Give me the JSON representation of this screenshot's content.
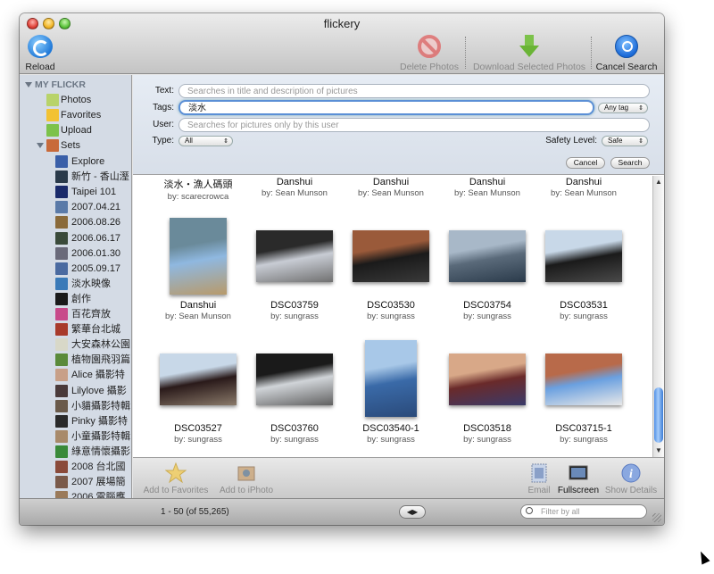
{
  "window": {
    "title": "flickery"
  },
  "toolbar": {
    "reload": "Reload",
    "delete": "Delete Photos",
    "download": "Download Selected Photos",
    "cancel_search": "Cancel Search"
  },
  "sidebar": {
    "section": "MY FLICKR",
    "items": [
      {
        "label": "Photos",
        "icon": "photos-icon",
        "color": "#b8d36a"
      },
      {
        "label": "Favorites",
        "icon": "star-icon",
        "color": "#f2c233"
      },
      {
        "label": "Upload",
        "icon": "upload-arrow-icon",
        "color": "#7cc24a"
      },
      {
        "label": "Sets",
        "icon": "sets-icon",
        "color": "#c86a3a"
      }
    ],
    "sets": [
      {
        "label": "Explore",
        "color": "#3a5fa8"
      },
      {
        "label": "新竹 - 香山溼",
        "color": "#2a3a4a"
      },
      {
        "label": "Taipei 101",
        "color": "#1a2a6a"
      },
      {
        "label": "2007.04.21",
        "color": "#5a7aa8"
      },
      {
        "label": "2006.08.26",
        "color": "#8a6a3a"
      },
      {
        "label": "2006.06.17",
        "color": "#3a4a3a"
      },
      {
        "label": "2006.01.30",
        "color": "#6a6a7a"
      },
      {
        "label": "2005.09.17",
        "color": "#4a6aa0"
      },
      {
        "label": "淡水映像",
        "color": "#3a7ab8"
      },
      {
        "label": "創作",
        "color": "#1a1a1a"
      },
      {
        "label": "百花齊放",
        "color": "#c84a8a"
      },
      {
        "label": "繁華台北城",
        "color": "#a83a2a"
      },
      {
        "label": "大安森林公園",
        "color": "#d8d8c8"
      },
      {
        "label": "植物園飛羽篇",
        "color": "#5a8a3a"
      },
      {
        "label": "Alice 攝影特",
        "color": "#c8a088"
      },
      {
        "label": "Lilylove 攝影",
        "color": "#4a3a3a"
      },
      {
        "label": "小貓攝影特輯",
        "color": "#6a5a4a"
      },
      {
        "label": "Pinky 攝影特",
        "color": "#2a2a2a"
      },
      {
        "label": "小童攝影特輯",
        "color": "#a88a6a"
      },
      {
        "label": "綠意情懷攝影",
        "color": "#3a8a3a"
      },
      {
        "label": "2008 台北國",
        "color": "#8a4a3a"
      },
      {
        "label": "2007 展場簡",
        "color": "#7a5a4a"
      },
      {
        "label": "2006 電腦應",
        "color": "#9a7a5a"
      }
    ]
  },
  "search": {
    "text_label": "Text:",
    "text_placeholder": "Searches in title and description of pictures",
    "tags_label": "Tags:",
    "tags_value": "淡水",
    "tags_mode": "Any tag",
    "user_label": "User:",
    "user_placeholder": "Searches for pictures only by this user",
    "type_label": "Type:",
    "type_value": "All",
    "safety_label": "Safety Level:",
    "safety_value": "Safe",
    "cancel_btn": "Cancel",
    "search_btn": "Search"
  },
  "photos": [
    {
      "name": "淡水・漁人碼頭",
      "by": "by: scarecrowca"
    },
    {
      "name": "Danshui",
      "by": "by: Sean Munson"
    },
    {
      "name": "Danshui",
      "by": "by: Sean Munson"
    },
    {
      "name": "Danshui",
      "by": "by: Sean Munson"
    },
    {
      "name": "Danshui",
      "by": "by: Sean Munson"
    },
    {
      "name": "Danshui",
      "by": "by: Sean Munson",
      "colors": [
        "#8fb8e0",
        "#6a8a9a",
        "#b89a6a"
      ]
    },
    {
      "name": "DSC03759",
      "by": "by: sungrass",
      "colors": [
        "#c8ccd4",
        "#2a2a2a",
        "#707070"
      ]
    },
    {
      "name": "DSC03530",
      "by": "by: sungrass",
      "colors": [
        "#1a1a1a",
        "#9a5a3a",
        "#3a3a3a"
      ]
    },
    {
      "name": "DSC03754",
      "by": "by: sungrass",
      "colors": [
        "#5a6a7a",
        "#a8b8c8",
        "#2a3a4a"
      ]
    },
    {
      "name": "DSC03531",
      "by": "by: sungrass",
      "colors": [
        "#1a1a1a",
        "#c8d8e8",
        "#4a4a4a"
      ]
    },
    {
      "name": "DSC03527",
      "by": "by: sungrass",
      "colors": [
        "#2a1a1a",
        "#c8d8e8",
        "#8a7a6a"
      ]
    },
    {
      "name": "DSC03760",
      "by": "by: sungrass",
      "colors": [
        "#d0d4d8",
        "#1a1a1a",
        "#606060"
      ]
    },
    {
      "name": "DSC03540-1",
      "by": "by: sungrass",
      "colors": [
        "#3a6aa8",
        "#a8c8e8",
        "#2a4a7a"
      ]
    },
    {
      "name": "DSC03518",
      "by": "by: sungrass",
      "colors": [
        "#6a2a2a",
        "#d8a888",
        "#3a3a6a"
      ]
    },
    {
      "name": "DSC03715-1",
      "by": "by: sungrass",
      "colors": [
        "#6aa0e0",
        "#b86a4a",
        "#e8e8e8"
      ]
    }
  ],
  "bottom": {
    "add_favorites": "Add to Favorites",
    "add_iphoto": "Add to iPhoto",
    "email": "Email",
    "fullscreen": "Fullscreen",
    "show_details": "Show Details"
  },
  "status": {
    "count": "1 - 50 (of 55,265)",
    "filter_placeholder": "Filter by all"
  }
}
